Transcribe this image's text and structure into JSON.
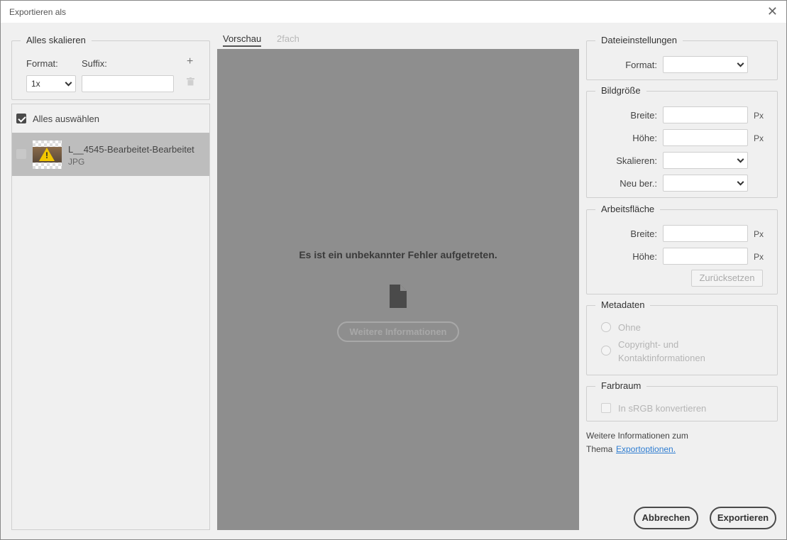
{
  "window": {
    "title": "Exportieren als",
    "close_icon": "close-icon"
  },
  "left": {
    "scale_legend": "Alles skalieren",
    "format_label": "Format:",
    "suffix_label": "Suffix:",
    "scale_value": "1x",
    "suffix_value": "",
    "add_icon": "plus-icon",
    "delete_icon": "trash-icon",
    "select_all_label": "Alles auswählen",
    "select_all_checked": true,
    "assets": [
      {
        "name": "L__4545-Bearbeitet-Bearbeitet",
        "type": "JPG",
        "checked": false
      }
    ]
  },
  "center": {
    "tabs": [
      {
        "label": "Vorschau",
        "active": true
      },
      {
        "label": "2fach",
        "active": false
      }
    ],
    "error_text": "Es ist ein unbekannter Fehler aufgetreten.",
    "file_icon": "file-icon",
    "info_button": "Weitere Informationen"
  },
  "right": {
    "file_settings": {
      "legend": "Dateieinstellungen",
      "format_label": "Format:",
      "format_value": ""
    },
    "image_size": {
      "legend": "Bildgröße",
      "width_label": "Breite:",
      "width_value": "",
      "width_unit": "Px",
      "height_label": "Höhe:",
      "height_value": "",
      "height_unit": "Px",
      "scale_label": "Skalieren:",
      "scale_value": "",
      "resample_label": "Neu ber.:",
      "resample_value": ""
    },
    "canvas": {
      "legend": "Arbeitsfläche",
      "width_label": "Breite:",
      "width_value": "",
      "width_unit": "Px",
      "height_label": "Höhe:",
      "height_value": "",
      "height_unit": "Px",
      "reset_button": "Zurücksetzen"
    },
    "metadata": {
      "legend": "Metadaten",
      "option_none": "Ohne",
      "option_copyright_line1": "Copyright- und",
      "option_copyright_line2": "Kontaktinformationen"
    },
    "colorspace": {
      "legend": "Farbraum",
      "srgb_label": "In sRGB konvertieren"
    },
    "more_info_prefix_line1": "Weitere Informationen zum",
    "more_info_prefix_line2": "Thema",
    "more_info_link": "Exportoptionen."
  },
  "footer": {
    "cancel_button": "Abbrechen",
    "export_button": "Exportieren"
  },
  "colors": {
    "preview_bg": "#8e8e8e",
    "selected_row": "#bdbdbd",
    "link": "#2f7dd1"
  }
}
